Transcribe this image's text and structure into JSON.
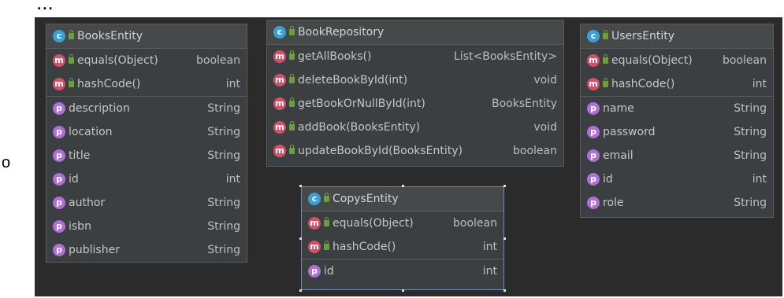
{
  "header_fragment": "...",
  "bullet": "o",
  "entities": {
    "books": {
      "title": "BooksEntity",
      "methods": [
        {
          "name": "equals(Object)",
          "type": "boolean"
        },
        {
          "name": "hashCode()",
          "type": "int"
        }
      ],
      "fields": [
        {
          "name": "description",
          "type": "String"
        },
        {
          "name": "location",
          "type": "String"
        },
        {
          "name": "title",
          "type": "String"
        },
        {
          "name": "id",
          "type": "int"
        },
        {
          "name": "author",
          "type": "String"
        },
        {
          "name": "isbn",
          "type": "String"
        },
        {
          "name": "publisher",
          "type": "String"
        }
      ]
    },
    "repo": {
      "title": "BookRepository",
      "methods": [
        {
          "name": "getAllBooks()",
          "type": "List<BooksEntity>"
        },
        {
          "name": "deleteBookById(int)",
          "type": "void"
        },
        {
          "name": "getBookOrNullById(int)",
          "type": "BooksEntity"
        },
        {
          "name": "addBook(BooksEntity)",
          "type": "void"
        },
        {
          "name": "updateBookById(BooksEntity)",
          "type": "boolean"
        }
      ]
    },
    "users": {
      "title": "UsersEntity",
      "methods": [
        {
          "name": "equals(Object)",
          "type": "boolean"
        },
        {
          "name": "hashCode()",
          "type": "int"
        }
      ],
      "fields": [
        {
          "name": "name",
          "type": "String"
        },
        {
          "name": "password",
          "type": "String"
        },
        {
          "name": "email",
          "type": "String"
        },
        {
          "name": "id",
          "type": "int"
        },
        {
          "name": "role",
          "type": "String"
        }
      ]
    },
    "copys": {
      "title": "CopysEntity",
      "methods": [
        {
          "name": "equals(Object)",
          "type": "boolean"
        },
        {
          "name": "hashCode()",
          "type": "int"
        }
      ],
      "fields": [
        {
          "name": "id",
          "type": "int"
        }
      ]
    }
  },
  "icons": {
    "class": "c",
    "method": "m",
    "field": "p"
  },
  "colors": {
    "canvas": "#2b2b2b",
    "box": "#3c3f41",
    "class_icon": "#3b9fd8",
    "method_icon": "#d2506a",
    "field_icon": "#b06fd8",
    "visibility": "#6a9f3a"
  }
}
